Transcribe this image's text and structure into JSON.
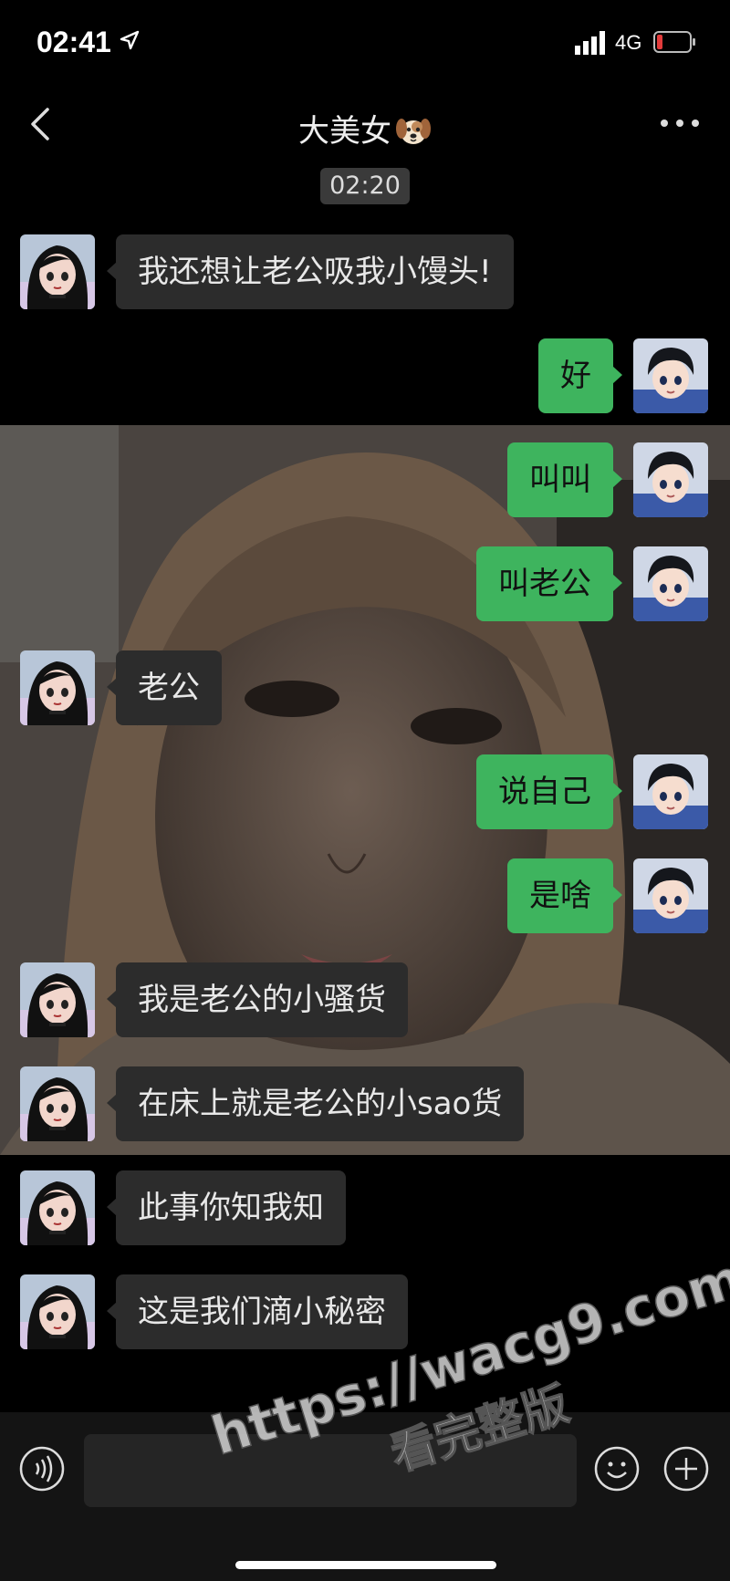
{
  "status_bar": {
    "time": "02:41",
    "network": "4G",
    "location_icon": "location-arrow-icon",
    "signal_icon": "signal-icon",
    "battery_icon": "battery-low-icon",
    "battery_color": "#e23b3b"
  },
  "header": {
    "title": "大美女",
    "title_emoji": "dog-face-icon",
    "back_icon": "chevron-left-icon",
    "more_icon": "more-dots-icon"
  },
  "timestamp": "02:20",
  "messages": [
    {
      "side": "in",
      "text": "我还想让老公吸我小馒头!"
    },
    {
      "side": "out",
      "text": "好"
    },
    {
      "side": "out",
      "text": "叫叫"
    },
    {
      "side": "out",
      "text": "叫老公"
    },
    {
      "side": "in",
      "text": "老公"
    },
    {
      "side": "out",
      "text": "说自己"
    },
    {
      "side": "out",
      "text": "是啥"
    },
    {
      "side": "in",
      "text": "我是老公的小骚货"
    },
    {
      "side": "in",
      "text": "在床上就是老公的小sao货"
    },
    {
      "side": "in",
      "text": "此事你知我知"
    },
    {
      "side": "in",
      "text": "这是我们滴小秘密"
    }
  ],
  "input_bar": {
    "voice_icon": "voice-icon",
    "emoji_icon": "smiley-icon",
    "plus_icon": "plus-circle-icon"
  },
  "watermark": {
    "url": "https://wacg9.com",
    "subtitle": "看完整版"
  },
  "colors": {
    "outgoing_bubble": "#3eb45e",
    "incoming_bubble": "#2c2c2c",
    "background": "#000000"
  }
}
